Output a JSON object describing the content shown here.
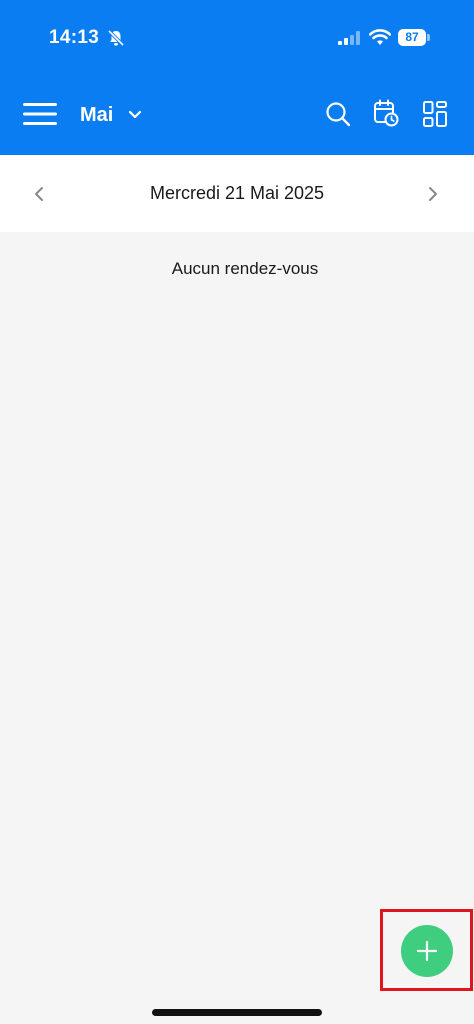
{
  "status_bar": {
    "time": "14:13",
    "battery_level": "87"
  },
  "app_bar": {
    "month_label": "Mai"
  },
  "date_nav": {
    "current_date": "Mercredi 21 Mai 2025"
  },
  "content": {
    "empty_message": "Aucun rendez-vous"
  },
  "colors": {
    "header_blue": "#0a7df3",
    "fab_green": "#3fcd80",
    "highlight_red": "#e0141e",
    "background": "#f5f5f5"
  },
  "icons": [
    "menu-icon",
    "chevron-down-icon",
    "search-icon",
    "calendar-clock-icon",
    "layout-grid-icon",
    "chevron-left-icon",
    "chevron-right-icon",
    "plus-icon",
    "bell-slash-icon",
    "signal-icon",
    "wifi-icon",
    "battery-icon"
  ]
}
